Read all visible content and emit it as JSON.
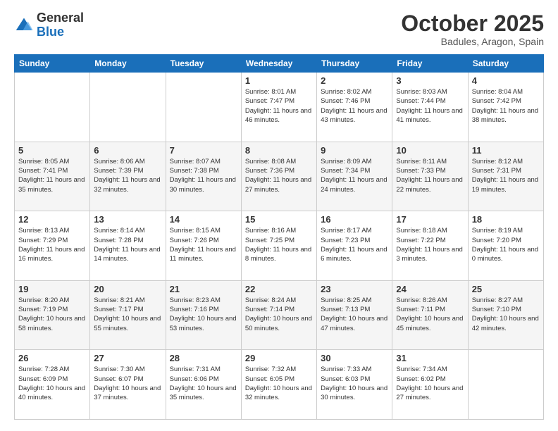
{
  "logo": {
    "general": "General",
    "blue": "Blue"
  },
  "header": {
    "title": "October 2025",
    "subtitle": "Badules, Aragon, Spain"
  },
  "days_of_week": [
    "Sunday",
    "Monday",
    "Tuesday",
    "Wednesday",
    "Thursday",
    "Friday",
    "Saturday"
  ],
  "weeks": [
    [
      {
        "day": "",
        "info": ""
      },
      {
        "day": "",
        "info": ""
      },
      {
        "day": "",
        "info": ""
      },
      {
        "day": "1",
        "info": "Sunrise: 8:01 AM\nSunset: 7:47 PM\nDaylight: 11 hours\nand 46 minutes."
      },
      {
        "day": "2",
        "info": "Sunrise: 8:02 AM\nSunset: 7:46 PM\nDaylight: 11 hours\nand 43 minutes."
      },
      {
        "day": "3",
        "info": "Sunrise: 8:03 AM\nSunset: 7:44 PM\nDaylight: 11 hours\nand 41 minutes."
      },
      {
        "day": "4",
        "info": "Sunrise: 8:04 AM\nSunset: 7:42 PM\nDaylight: 11 hours\nand 38 minutes."
      }
    ],
    [
      {
        "day": "5",
        "info": "Sunrise: 8:05 AM\nSunset: 7:41 PM\nDaylight: 11 hours\nand 35 minutes."
      },
      {
        "day": "6",
        "info": "Sunrise: 8:06 AM\nSunset: 7:39 PM\nDaylight: 11 hours\nand 32 minutes."
      },
      {
        "day": "7",
        "info": "Sunrise: 8:07 AM\nSunset: 7:38 PM\nDaylight: 11 hours\nand 30 minutes."
      },
      {
        "day": "8",
        "info": "Sunrise: 8:08 AM\nSunset: 7:36 PM\nDaylight: 11 hours\nand 27 minutes."
      },
      {
        "day": "9",
        "info": "Sunrise: 8:09 AM\nSunset: 7:34 PM\nDaylight: 11 hours\nand 24 minutes."
      },
      {
        "day": "10",
        "info": "Sunrise: 8:11 AM\nSunset: 7:33 PM\nDaylight: 11 hours\nand 22 minutes."
      },
      {
        "day": "11",
        "info": "Sunrise: 8:12 AM\nSunset: 7:31 PM\nDaylight: 11 hours\nand 19 minutes."
      }
    ],
    [
      {
        "day": "12",
        "info": "Sunrise: 8:13 AM\nSunset: 7:29 PM\nDaylight: 11 hours\nand 16 minutes."
      },
      {
        "day": "13",
        "info": "Sunrise: 8:14 AM\nSunset: 7:28 PM\nDaylight: 11 hours\nand 14 minutes."
      },
      {
        "day": "14",
        "info": "Sunrise: 8:15 AM\nSunset: 7:26 PM\nDaylight: 11 hours\nand 11 minutes."
      },
      {
        "day": "15",
        "info": "Sunrise: 8:16 AM\nSunset: 7:25 PM\nDaylight: 11 hours\nand 8 minutes."
      },
      {
        "day": "16",
        "info": "Sunrise: 8:17 AM\nSunset: 7:23 PM\nDaylight: 11 hours\nand 6 minutes."
      },
      {
        "day": "17",
        "info": "Sunrise: 8:18 AM\nSunset: 7:22 PM\nDaylight: 11 hours\nand 3 minutes."
      },
      {
        "day": "18",
        "info": "Sunrise: 8:19 AM\nSunset: 7:20 PM\nDaylight: 11 hours\nand 0 minutes."
      }
    ],
    [
      {
        "day": "19",
        "info": "Sunrise: 8:20 AM\nSunset: 7:19 PM\nDaylight: 10 hours\nand 58 minutes."
      },
      {
        "day": "20",
        "info": "Sunrise: 8:21 AM\nSunset: 7:17 PM\nDaylight: 10 hours\nand 55 minutes."
      },
      {
        "day": "21",
        "info": "Sunrise: 8:23 AM\nSunset: 7:16 PM\nDaylight: 10 hours\nand 53 minutes."
      },
      {
        "day": "22",
        "info": "Sunrise: 8:24 AM\nSunset: 7:14 PM\nDaylight: 10 hours\nand 50 minutes."
      },
      {
        "day": "23",
        "info": "Sunrise: 8:25 AM\nSunset: 7:13 PM\nDaylight: 10 hours\nand 47 minutes."
      },
      {
        "day": "24",
        "info": "Sunrise: 8:26 AM\nSunset: 7:11 PM\nDaylight: 10 hours\nand 45 minutes."
      },
      {
        "day": "25",
        "info": "Sunrise: 8:27 AM\nSunset: 7:10 PM\nDaylight: 10 hours\nand 42 minutes."
      }
    ],
    [
      {
        "day": "26",
        "info": "Sunrise: 7:28 AM\nSunset: 6:09 PM\nDaylight: 10 hours\nand 40 minutes."
      },
      {
        "day": "27",
        "info": "Sunrise: 7:30 AM\nSunset: 6:07 PM\nDaylight: 10 hours\nand 37 minutes."
      },
      {
        "day": "28",
        "info": "Sunrise: 7:31 AM\nSunset: 6:06 PM\nDaylight: 10 hours\nand 35 minutes."
      },
      {
        "day": "29",
        "info": "Sunrise: 7:32 AM\nSunset: 6:05 PM\nDaylight: 10 hours\nand 32 minutes."
      },
      {
        "day": "30",
        "info": "Sunrise: 7:33 AM\nSunset: 6:03 PM\nDaylight: 10 hours\nand 30 minutes."
      },
      {
        "day": "31",
        "info": "Sunrise: 7:34 AM\nSunset: 6:02 PM\nDaylight: 10 hours\nand 27 minutes."
      },
      {
        "day": "",
        "info": ""
      }
    ]
  ]
}
